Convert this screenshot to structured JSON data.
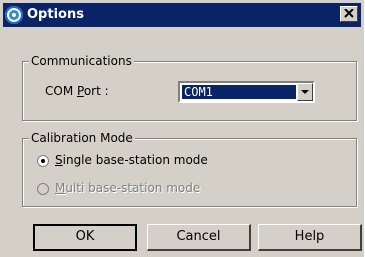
{
  "window": {
    "title": "Options",
    "icon": "app-logo-icon",
    "close_label": "×"
  },
  "communications": {
    "group_label": "Communications",
    "com_port_label": "COM Port :",
    "com_port_value": "COM1"
  },
  "calibration": {
    "group_label": "Calibration Mode",
    "single_label": "Single base-station mode",
    "single_checked": true,
    "multi_label": "Multi base-station mode",
    "multi_enabled": false
  },
  "buttons": {
    "ok": "OK",
    "cancel": "Cancel",
    "help": "Help"
  }
}
